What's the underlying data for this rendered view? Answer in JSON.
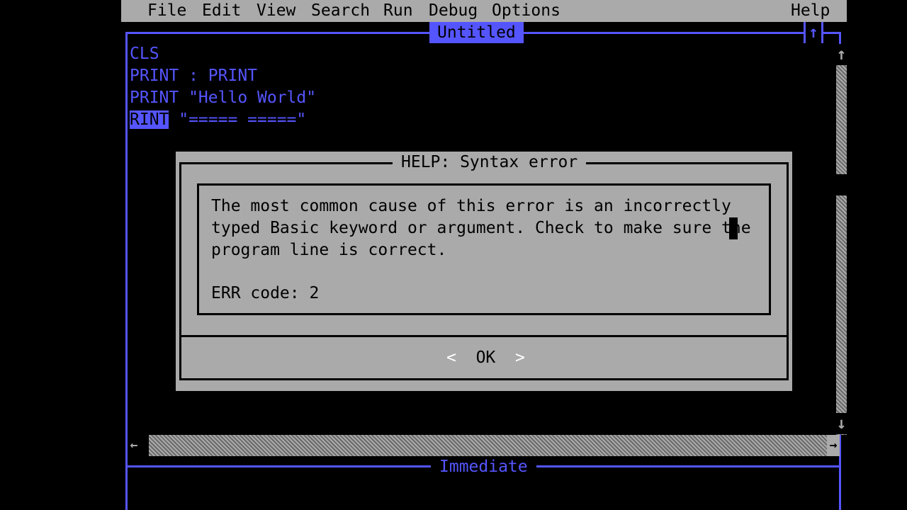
{
  "menubar": {
    "items": [
      "File",
      "Edit",
      "View",
      "Search",
      "Run",
      "Debug",
      "Options"
    ],
    "help": "Help"
  },
  "editor": {
    "title": "Untitled",
    "maximize_glyph": "↑",
    "lines": [
      {
        "text": "CLS"
      },
      {
        "text": "PRINT : PRINT"
      },
      {
        "text": "PRINT \"Hello World\""
      },
      {
        "highlight": "RINT",
        "rest": " \"===== =====\""
      }
    ]
  },
  "scrollbar": {
    "up_arrow": "↑",
    "down_arrow": "↓",
    "left_arrow": "←",
    "right_arrow": "→"
  },
  "immediate": {
    "title": "Immediate"
  },
  "dialog": {
    "title": "HELP: Syntax error",
    "lines": [
      "The most common cause of this error is an incorrectly",
      "typed Basic keyword or argument. Check to make sure the",
      "program line is correct."
    ],
    "err_code": "ERR code: 2",
    "ok_left": "<",
    "ok_label": "OK",
    "ok_right": ">"
  },
  "colors": {
    "background": "#000000",
    "text_blue": "#5555ff",
    "gray": "#aaaaaa",
    "white": "#ffffff"
  }
}
